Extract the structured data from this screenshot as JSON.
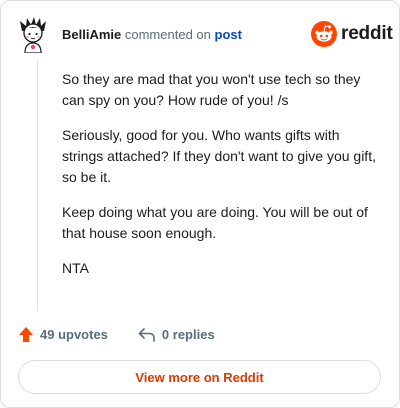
{
  "comment": {
    "username": "BelliAmie",
    "action": "commented on",
    "post_link": "post",
    "paragraphs": [
      "So they are mad that you won't use tech so they can spy on you? How rude of you! /s",
      "Seriously, good for you. Who wants gifts with strings attached? If they don't want to give you gift, so be it.",
      "Keep doing what you are doing. You will be out of that house soon enough.",
      "NTA"
    ]
  },
  "brand": {
    "name": "reddit",
    "color": "#ff4500"
  },
  "stats": {
    "upvotes": "49 upvotes",
    "replies": "0 replies"
  },
  "footer": {
    "view_more": "View more on Reddit"
  },
  "colors": {
    "accent": "#d93a00",
    "upvote": "#ff4500",
    "link": "#0a4bb3",
    "muted": "#576f76"
  }
}
